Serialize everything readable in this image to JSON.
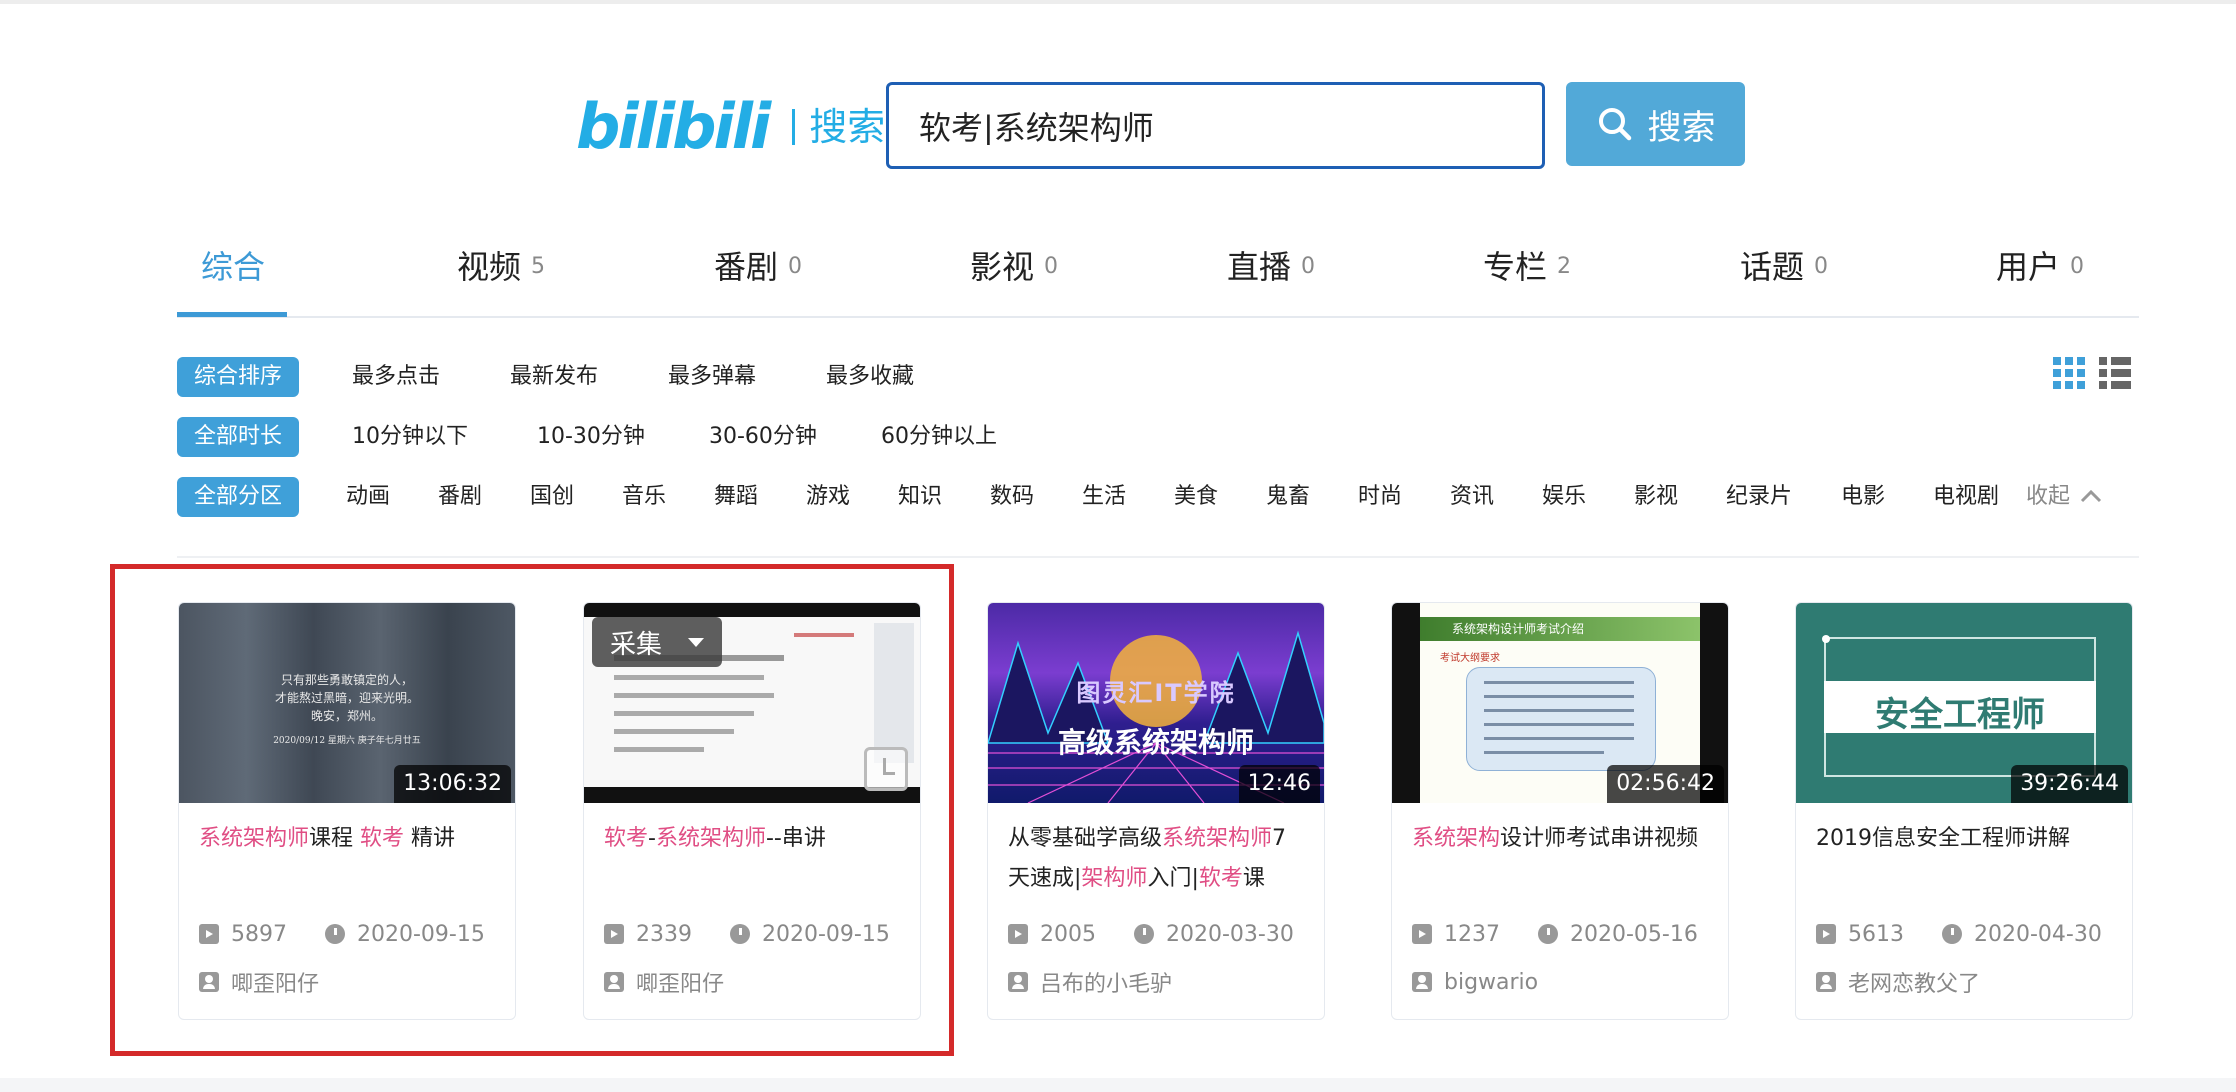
{
  "header": {
    "logo_text": "bilibili",
    "logo_sub": "搜索",
    "search_value": "软考|系统架构师",
    "search_button": "搜索"
  },
  "tabs": [
    {
      "label": "综合",
      "count": ""
    },
    {
      "label": "视频",
      "count": "5"
    },
    {
      "label": "番剧",
      "count": "0"
    },
    {
      "label": "影视",
      "count": "0"
    },
    {
      "label": "直播",
      "count": "0"
    },
    {
      "label": "专栏",
      "count": "2"
    },
    {
      "label": "话题",
      "count": "0"
    },
    {
      "label": "用户",
      "count": "0"
    }
  ],
  "filters": {
    "sort": {
      "selected": "综合排序",
      "options": [
        "最多点击",
        "最新发布",
        "最多弹幕",
        "最多收藏"
      ]
    },
    "duration": {
      "selected": "全部时长",
      "options": [
        "10分钟以下",
        "10-30分钟",
        "30-60分钟",
        "60分钟以上"
      ]
    },
    "zone": {
      "selected": "全部分区",
      "options": [
        "动画",
        "番剧",
        "国创",
        "音乐",
        "舞蹈",
        "游戏",
        "知识",
        "数码",
        "生活",
        "美食",
        "鬼畜",
        "时尚",
        "资讯",
        "娱乐",
        "影视",
        "纪录片",
        "电影",
        "电视剧"
      ],
      "collapse": "收起"
    }
  },
  "cards": [
    {
      "duration": "13:06:32",
      "title_parts": [
        {
          "t": "系统架构师",
          "hl": true
        },
        {
          "t": "课程 ",
          "hl": false
        },
        {
          "t": "软考",
          "hl": true
        },
        {
          "t": " 精讲",
          "hl": false
        }
      ],
      "plays": "5897",
      "date": "2020-09-15",
      "uploader": "唧歪阳仔",
      "thumb_lines": [
        "只有那些勇敢镇定的人，",
        "才能熬过黑暗，迎来光明。",
        "晚安，郑州。",
        "2020/09/12 星期六 庚子年七月廿五"
      ]
    },
    {
      "duration": "",
      "title_parts": [
        {
          "t": "软考",
          "hl": true
        },
        {
          "t": "-",
          "hl": false
        },
        {
          "t": "系统架构师",
          "hl": true
        },
        {
          "t": "--串讲",
          "hl": false
        }
      ],
      "plays": "2339",
      "date": "2020-09-15",
      "uploader": "唧歪阳仔",
      "collect_label": "采集"
    },
    {
      "duration": "12:46",
      "title_parts": [
        {
          "t": "从零基础学高级",
          "hl": false
        },
        {
          "t": "系统架构师",
          "hl": true
        },
        {
          "t": "7天速成|",
          "hl": false
        },
        {
          "t": "架构师",
          "hl": true
        },
        {
          "t": "入门|",
          "hl": false
        },
        {
          "t": "软考",
          "hl": true
        },
        {
          "t": "课",
          "hl": false
        }
      ],
      "plays": "2005",
      "date": "2020-03-30",
      "uploader": "吕布的小毛驴",
      "thumb_lines": [
        "图灵汇IT学院",
        "高级系统架构师"
      ]
    },
    {
      "duration": "02:56:42",
      "title_parts": [
        {
          "t": "系统架构",
          "hl": true
        },
        {
          "t": "设计师考试串讲视频",
          "hl": false
        }
      ],
      "plays": "1237",
      "date": "2020-05-16",
      "uploader": "bigwario",
      "thumb_lines": [
        "系统架构设计师考试介绍",
        "考试大纲要求"
      ]
    },
    {
      "duration": "39:26:44",
      "title_parts": [
        {
          "t": "2019信息安全工程师讲解",
          "hl": false
        }
      ],
      "plays": "5613",
      "date": "2020-04-30",
      "uploader": "老网恋教父了",
      "thumb_lines": [
        "安全工程师"
      ]
    }
  ]
}
